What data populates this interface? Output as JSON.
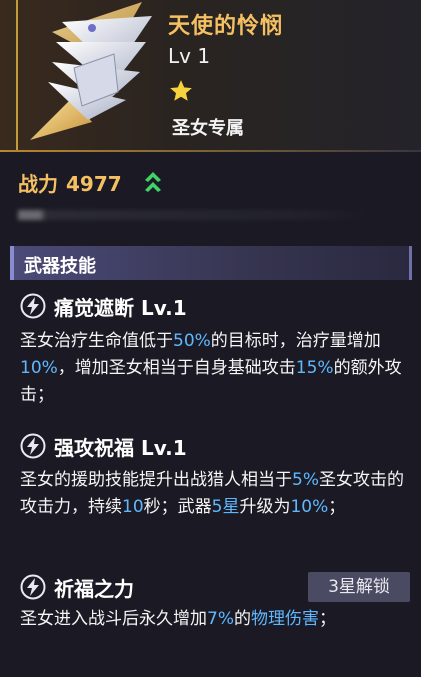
{
  "header": {
    "title": "天使的怜悯",
    "level": "Lv 1",
    "stars": 1,
    "exclusive": "圣女专属",
    "colors": {
      "title": "#f4c062",
      "accent": "#c59a3a"
    }
  },
  "stats": {
    "power_label": "战力",
    "power_value": "4977",
    "trend_icon": "double-chevron-up-icon"
  },
  "section": {
    "title": "武器技能"
  },
  "skills": [
    {
      "name": "痛觉遮断 Lv.1",
      "icon": "lightning-circle-icon",
      "desc": [
        {
          "t": "圣女治疗生命值低于",
          "h": false
        },
        {
          "t": "50%",
          "h": true
        },
        {
          "t": "的目标时，治疗量增加",
          "h": false
        },
        {
          "t": "10%",
          "h": true
        },
        {
          "t": "，增加圣女相当于自身基础攻击",
          "h": false
        },
        {
          "t": "15%",
          "h": true
        },
        {
          "t": "的额外攻击；",
          "h": false
        }
      ]
    },
    {
      "name": "强攻祝福 Lv.1",
      "icon": "lightning-circle-icon",
      "desc": [
        {
          "t": "圣女的援助技能提升出战猎人相当于",
          "h": false
        },
        {
          "t": "5%",
          "h": true
        },
        {
          "t": "圣女攻击的攻击力，持续",
          "h": false
        },
        {
          "t": "10",
          "h": true
        },
        {
          "t": "秒；武器",
          "h": false
        },
        {
          "t": "5星",
          "h": true
        },
        {
          "t": "升级为",
          "h": false
        },
        {
          "t": "10%",
          "h": true
        },
        {
          "t": "；",
          "h": false
        }
      ]
    },
    {
      "name": "祈福之力",
      "icon": "lightning-circle-icon",
      "badge": "3星解锁",
      "desc": [
        {
          "t": "圣女进入战斗后永久增加",
          "h": false
        },
        {
          "t": "7%",
          "h": true
        },
        {
          "t": "的",
          "h": false
        },
        {
          "t": "物理伤害",
          "h": true
        },
        {
          "t": "；",
          "h": false
        }
      ]
    }
  ],
  "colors": {
    "highlight": "#5fb8ff",
    "background": "#1b1a24",
    "section": "#4b4a78"
  }
}
